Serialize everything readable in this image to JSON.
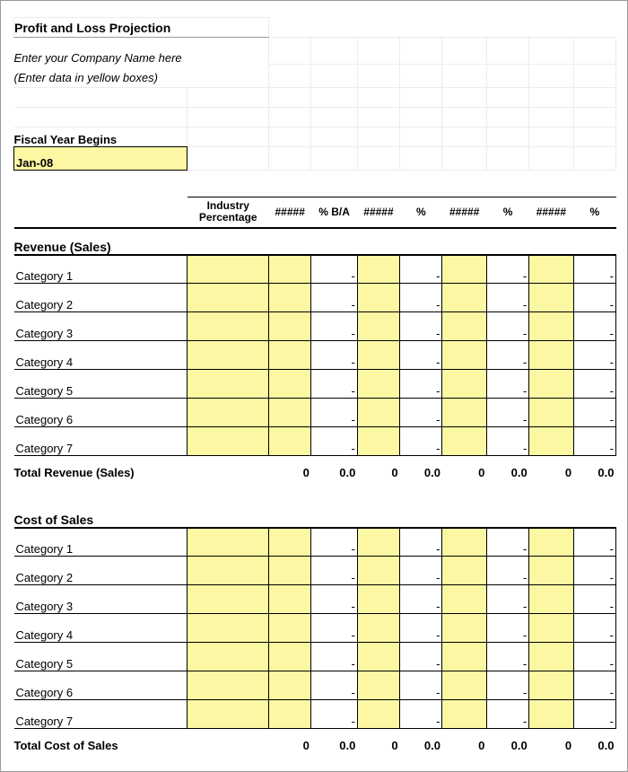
{
  "title": "Profit and Loss Projection",
  "company_placeholder": "Enter your Company Name here",
  "instructions": "(Enter data in yellow boxes)",
  "fiscal_year": {
    "label": "Fiscal Year Begins",
    "value": "Jan-08"
  },
  "col_headers": [
    "Industry Percentage",
    "#####",
    "% B/A",
    "#####",
    "%",
    "#####",
    "%",
    "#####",
    "%"
  ],
  "sections": [
    {
      "header": "Revenue (Sales)",
      "categories": [
        "Category 1",
        "Category 2",
        "Category 3",
        "Category 4",
        "Category 5",
        "Category 6",
        "Category 7"
      ],
      "total_label": "Total Revenue (Sales)",
      "totals": [
        "",
        "0",
        "0.0",
        "0",
        "0.0",
        "0",
        "0.0",
        "0",
        "0.0"
      ]
    },
    {
      "header": "Cost of Sales",
      "categories": [
        "Category 1",
        "Category 2",
        "Category 3",
        "Category 4",
        "Category 5",
        "Category 6",
        "Category 7"
      ],
      "total_label": "Total Cost of Sales",
      "totals": [
        "",
        "0",
        "0.0",
        "0",
        "0.0",
        "0",
        "0.0",
        "0",
        "0.0"
      ]
    }
  ],
  "dash": "-"
}
